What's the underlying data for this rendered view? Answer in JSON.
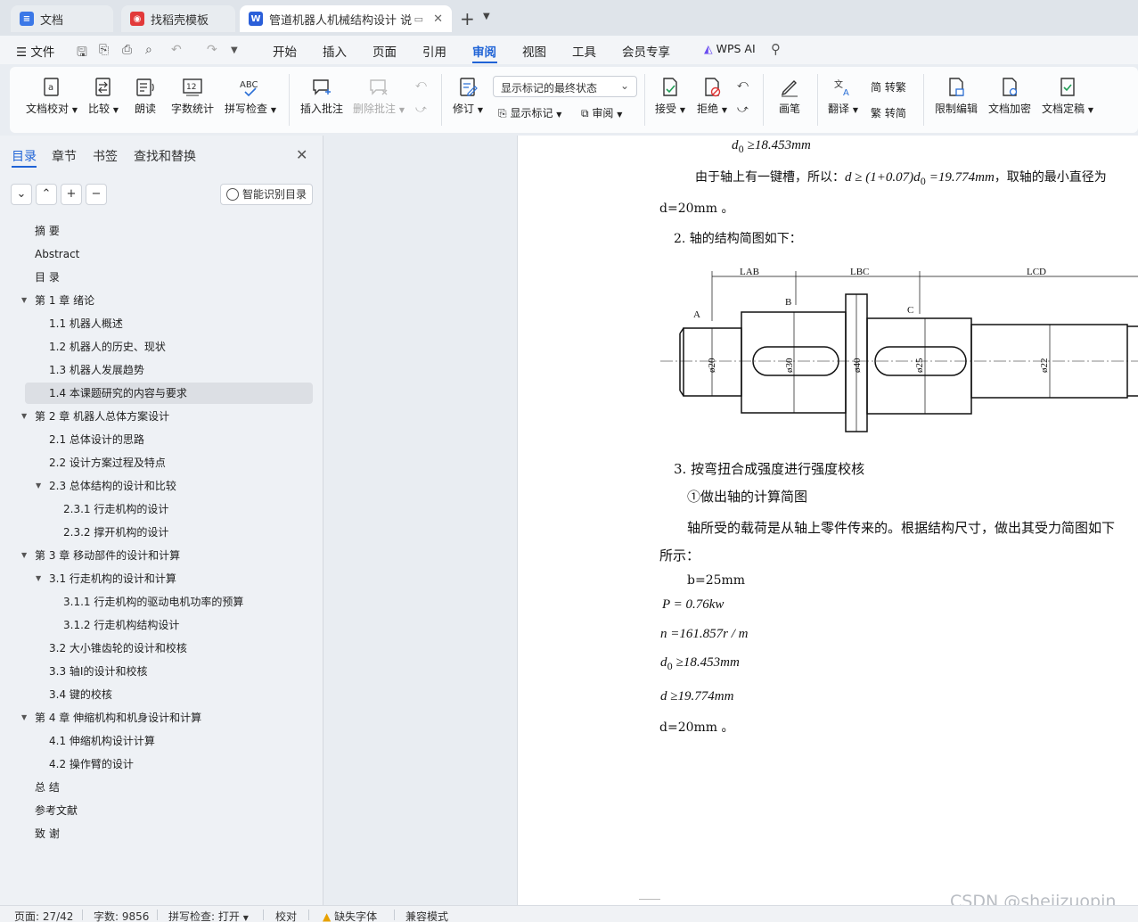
{
  "tabs": [
    {
      "label": "文档",
      "state": "inactive",
      "icon": "docs-icon",
      "color": "#3b78e7"
    },
    {
      "label": "找稻壳模板",
      "state": "inactive",
      "icon": "docer-icon",
      "color": "#e23a3a"
    },
    {
      "label": "管道机器人机械结构设计 说明",
      "state": "active",
      "icon": "word-icon",
      "color": "#2b5fd9"
    }
  ],
  "menu": {
    "file": "文件",
    "items": [
      "开始",
      "插入",
      "页面",
      "引用",
      "审阅",
      "视图",
      "工具",
      "会员专享"
    ],
    "active": "审阅",
    "wps_ai": "WPS AI"
  },
  "ribbon": {
    "doc_check": "文档校对",
    "compare": "比较",
    "read_aloud": "朗读",
    "word_count": "字数统计",
    "spell_check": "拼写检查",
    "spell_icon_text": "ABC",
    "insert_comment": "插入批注",
    "delete_comment": "删除批注",
    "revise": "修订",
    "mark_state": "显示标记的最终状态",
    "show_markup": "显示标记",
    "review": "审阅",
    "accept": "接受",
    "reject": "拒绝",
    "pen": "画笔",
    "translate": "翻译",
    "to_traditional": "简 转繁",
    "to_simplified": "繁 转简",
    "restrict_edit": "限制编辑",
    "encrypt": "文档加密",
    "finalize": "文档定稿"
  },
  "nav": {
    "tabs": [
      "目录",
      "章节",
      "书签",
      "查找和替换"
    ],
    "active_tab": "目录",
    "smart_toc": "智能识别目录",
    "items": [
      {
        "label": "摘  要",
        "level": 1,
        "toggle": ""
      },
      {
        "label": "Abstract",
        "level": 1,
        "toggle": ""
      },
      {
        "label": "目  录",
        "level": 1,
        "toggle": ""
      },
      {
        "label": "第 1 章  绪论",
        "level": 1,
        "toggle": "open"
      },
      {
        "label": "1.1  机器人概述",
        "level": 2,
        "toggle": ""
      },
      {
        "label": "1.2  机器人的历史、现状",
        "level": 2,
        "toggle": ""
      },
      {
        "label": "1.3 机器人发展趋势",
        "level": 2,
        "toggle": ""
      },
      {
        "label": "1.4  本课题研究的内容与要求",
        "level": 2,
        "toggle": "",
        "selected": true
      },
      {
        "label": "第 2 章  机器人总体方案设计",
        "level": 1,
        "toggle": "open"
      },
      {
        "label": "2.1 总体设计的思路",
        "level": 2,
        "toggle": ""
      },
      {
        "label": "2.2  设计方案过程及特点",
        "level": 2,
        "toggle": ""
      },
      {
        "label": "2.3  总体结构的设计和比较",
        "level": 2,
        "toggle": "open"
      },
      {
        "label": "2.3.1  行走机构的设计",
        "level": 3,
        "toggle": ""
      },
      {
        "label": "2.3.2  撑开机构的设计",
        "level": 3,
        "toggle": ""
      },
      {
        "label": "第 3 章  移动部件的设计和计算",
        "level": 1,
        "toggle": "open"
      },
      {
        "label": "3.1  行走机构的设计和计算",
        "level": 2,
        "toggle": "open"
      },
      {
        "label": "3.1.1  行走机构的驱动电机功率的预算",
        "level": 3,
        "toggle": ""
      },
      {
        "label": "3.1.2  行走机构结构设计",
        "level": 3,
        "toggle": ""
      },
      {
        "label": "3.2 大小锥齿轮的设计和校核",
        "level": 2,
        "toggle": ""
      },
      {
        "label": "3.3  轴Ⅰ的设计和校核",
        "level": 2,
        "toggle": ""
      },
      {
        "label": "3.4  键的校核",
        "level": 2,
        "toggle": ""
      },
      {
        "label": "第 4 章  伸缩机构和机身设计和计算",
        "level": 1,
        "toggle": "open"
      },
      {
        "label": "4.1  伸缩机构设计计算",
        "level": 2,
        "toggle": ""
      },
      {
        "label": "4.2  操作臂的设计",
        "level": 2,
        "toggle": ""
      },
      {
        "label": "总  结",
        "level": 1,
        "toggle": ""
      },
      {
        "label": "参考文献",
        "level": 1,
        "toggle": ""
      },
      {
        "label": "致  谢",
        "level": 1,
        "toggle": ""
      }
    ]
  },
  "doc": {
    "l1_d0": "d",
    "l1_sub": "0",
    "l1_rest": " ≥18.453mm",
    "l2_prefix": "由于轴上有一键槽，所以：",
    "l2_formula_a": "d ≥ (1+0.07)d",
    "l2_formula_sub": "0",
    "l2_formula_b": " =19.774mm",
    "l2_suffix": "，取轴的最小直径为",
    "l3": "d=20mm 。",
    "l4": "2.  轴的结构简图如下：",
    "drawing": {
      "labels_top": [
        "LAB",
        "LBC",
        "LCD"
      ],
      "points": [
        "A",
        "B",
        "C"
      ],
      "diameters": [
        "ø20",
        "ø30",
        "ø40",
        "ø25",
        "ø22"
      ]
    },
    "l5": "3.  按弯扭合成强度进行强度校核",
    "l6": "①做出轴的计算简图",
    "l7": "轴所受的载荷是从轴上零件传来的。根据结构尺寸，做出其受力简图如下",
    "l8": "所示：",
    "l9": "b=25mm",
    "l10": "P = 0.76kw",
    "l11": "n =161.857r / m",
    "l12_d": "d",
    "l12_sub": "0",
    "l12_rest": " ≥18.453mm",
    "l13": "d ≥19.774mm",
    "l14": "d=20mm 。"
  },
  "status": {
    "page": "页面: 27/42",
    "words": "字数: 9856",
    "spell": "拼写检查: 打开",
    "proof": "校对",
    "missing_font": "缺失字体",
    "compat": "兼容模式"
  },
  "watermark": "CSDN @shejizuopin"
}
